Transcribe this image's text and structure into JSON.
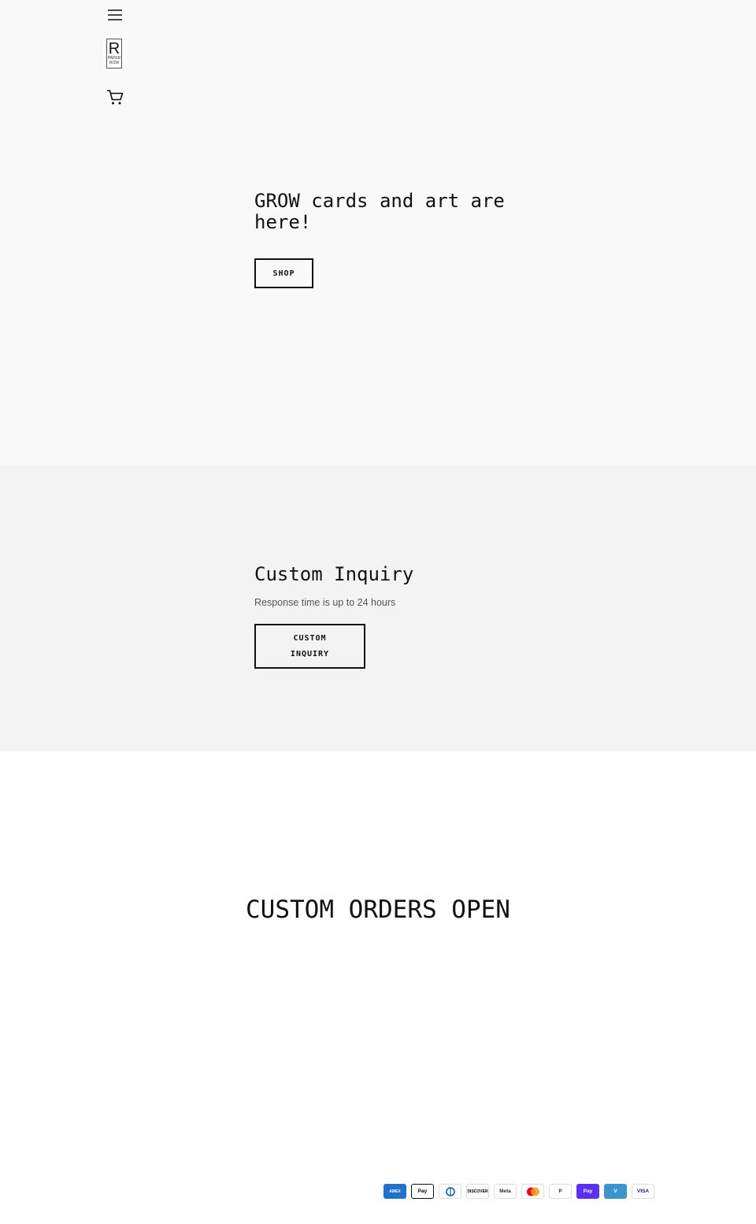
{
  "header": {
    "logo": {
      "letter": "R",
      "line1": "PAPER",
      "line2": "ROW"
    }
  },
  "hero": {
    "title": "GROW cards and art are here!",
    "button_label": "SHOP",
    "background": "#f9f9f9"
  },
  "inquiry": {
    "title": "Custom Inquiry",
    "subtitle": "Response time is up to 24 hours",
    "button_label": "CUSTOM INQUIRY",
    "background": "#f3f3f3"
  },
  "orders": {
    "title": "CUSTOM ORDERS OPEN"
  },
  "payments": [
    {
      "name": "amex-icon",
      "label": "AMEX",
      "bg": "#1f72cd",
      "fg": "#ffffff"
    },
    {
      "name": "apple-pay-icon",
      "label": "Pay",
      "bg": "#ffffff",
      "fg": "#000000"
    },
    {
      "name": "diners-club-icon",
      "label": "",
      "bg": "#ffffff",
      "fg": "#0165ac"
    },
    {
      "name": "discover-icon",
      "label": "DISCOVER",
      "bg": "#ffffff",
      "fg": "#000000"
    },
    {
      "name": "meta-pay-icon",
      "label": "Meta",
      "bg": "#ffffff",
      "fg": "#333333"
    },
    {
      "name": "mastercard-icon",
      "label": "",
      "bg": "#ffffff",
      "fg": "#ff5f00"
    },
    {
      "name": "paypal-icon",
      "label": "P",
      "bg": "#ffffff",
      "fg": "#003087"
    },
    {
      "name": "shop-pay-icon",
      "label": "Pay",
      "bg": "#5a31f4",
      "fg": "#ffffff"
    },
    {
      "name": "venmo-icon",
      "label": "V",
      "bg": "#3d95ce",
      "fg": "#ffffff"
    },
    {
      "name": "visa-icon",
      "label": "VISA",
      "bg": "#ffffff",
      "fg": "#1a1f71"
    }
  ]
}
